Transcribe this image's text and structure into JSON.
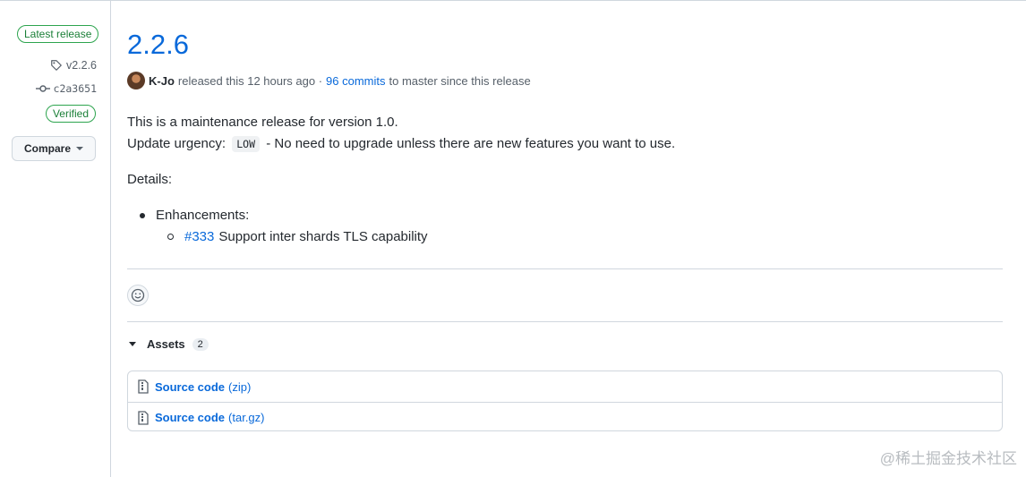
{
  "sidebar": {
    "latest_badge": "Latest release",
    "tag": "v2.2.6",
    "commit": "c2a3651",
    "verified_badge": "Verified",
    "compare_label": "Compare"
  },
  "release": {
    "title": "2.2.6",
    "author": "K-Jo",
    "released_text": "released this 12 hours ago ·",
    "commits_link": "96 commits",
    "commits_suffix": "to master since this release"
  },
  "body": {
    "line1": "This is a maintenance release for version 1.0.",
    "urgency_prefix": "Update urgency:",
    "urgency_code": "LOW",
    "urgency_suffix": "- No need to upgrade unless there are new features you want to use.",
    "details": "Details:",
    "bullet": "Enhancements:",
    "sub_link": "#333",
    "sub_text": "Support inter shards TLS capability"
  },
  "assets": {
    "label": "Assets",
    "count": "2",
    "items": [
      {
        "name": "Source code",
        "ext": "(zip)"
      },
      {
        "name": "Source code",
        "ext": "(tar.gz)"
      }
    ]
  },
  "watermark": "@稀土掘金技术社区",
  "colors": {
    "link": "#0969da",
    "success": "#1a7f37",
    "border": "#d0d7de"
  }
}
